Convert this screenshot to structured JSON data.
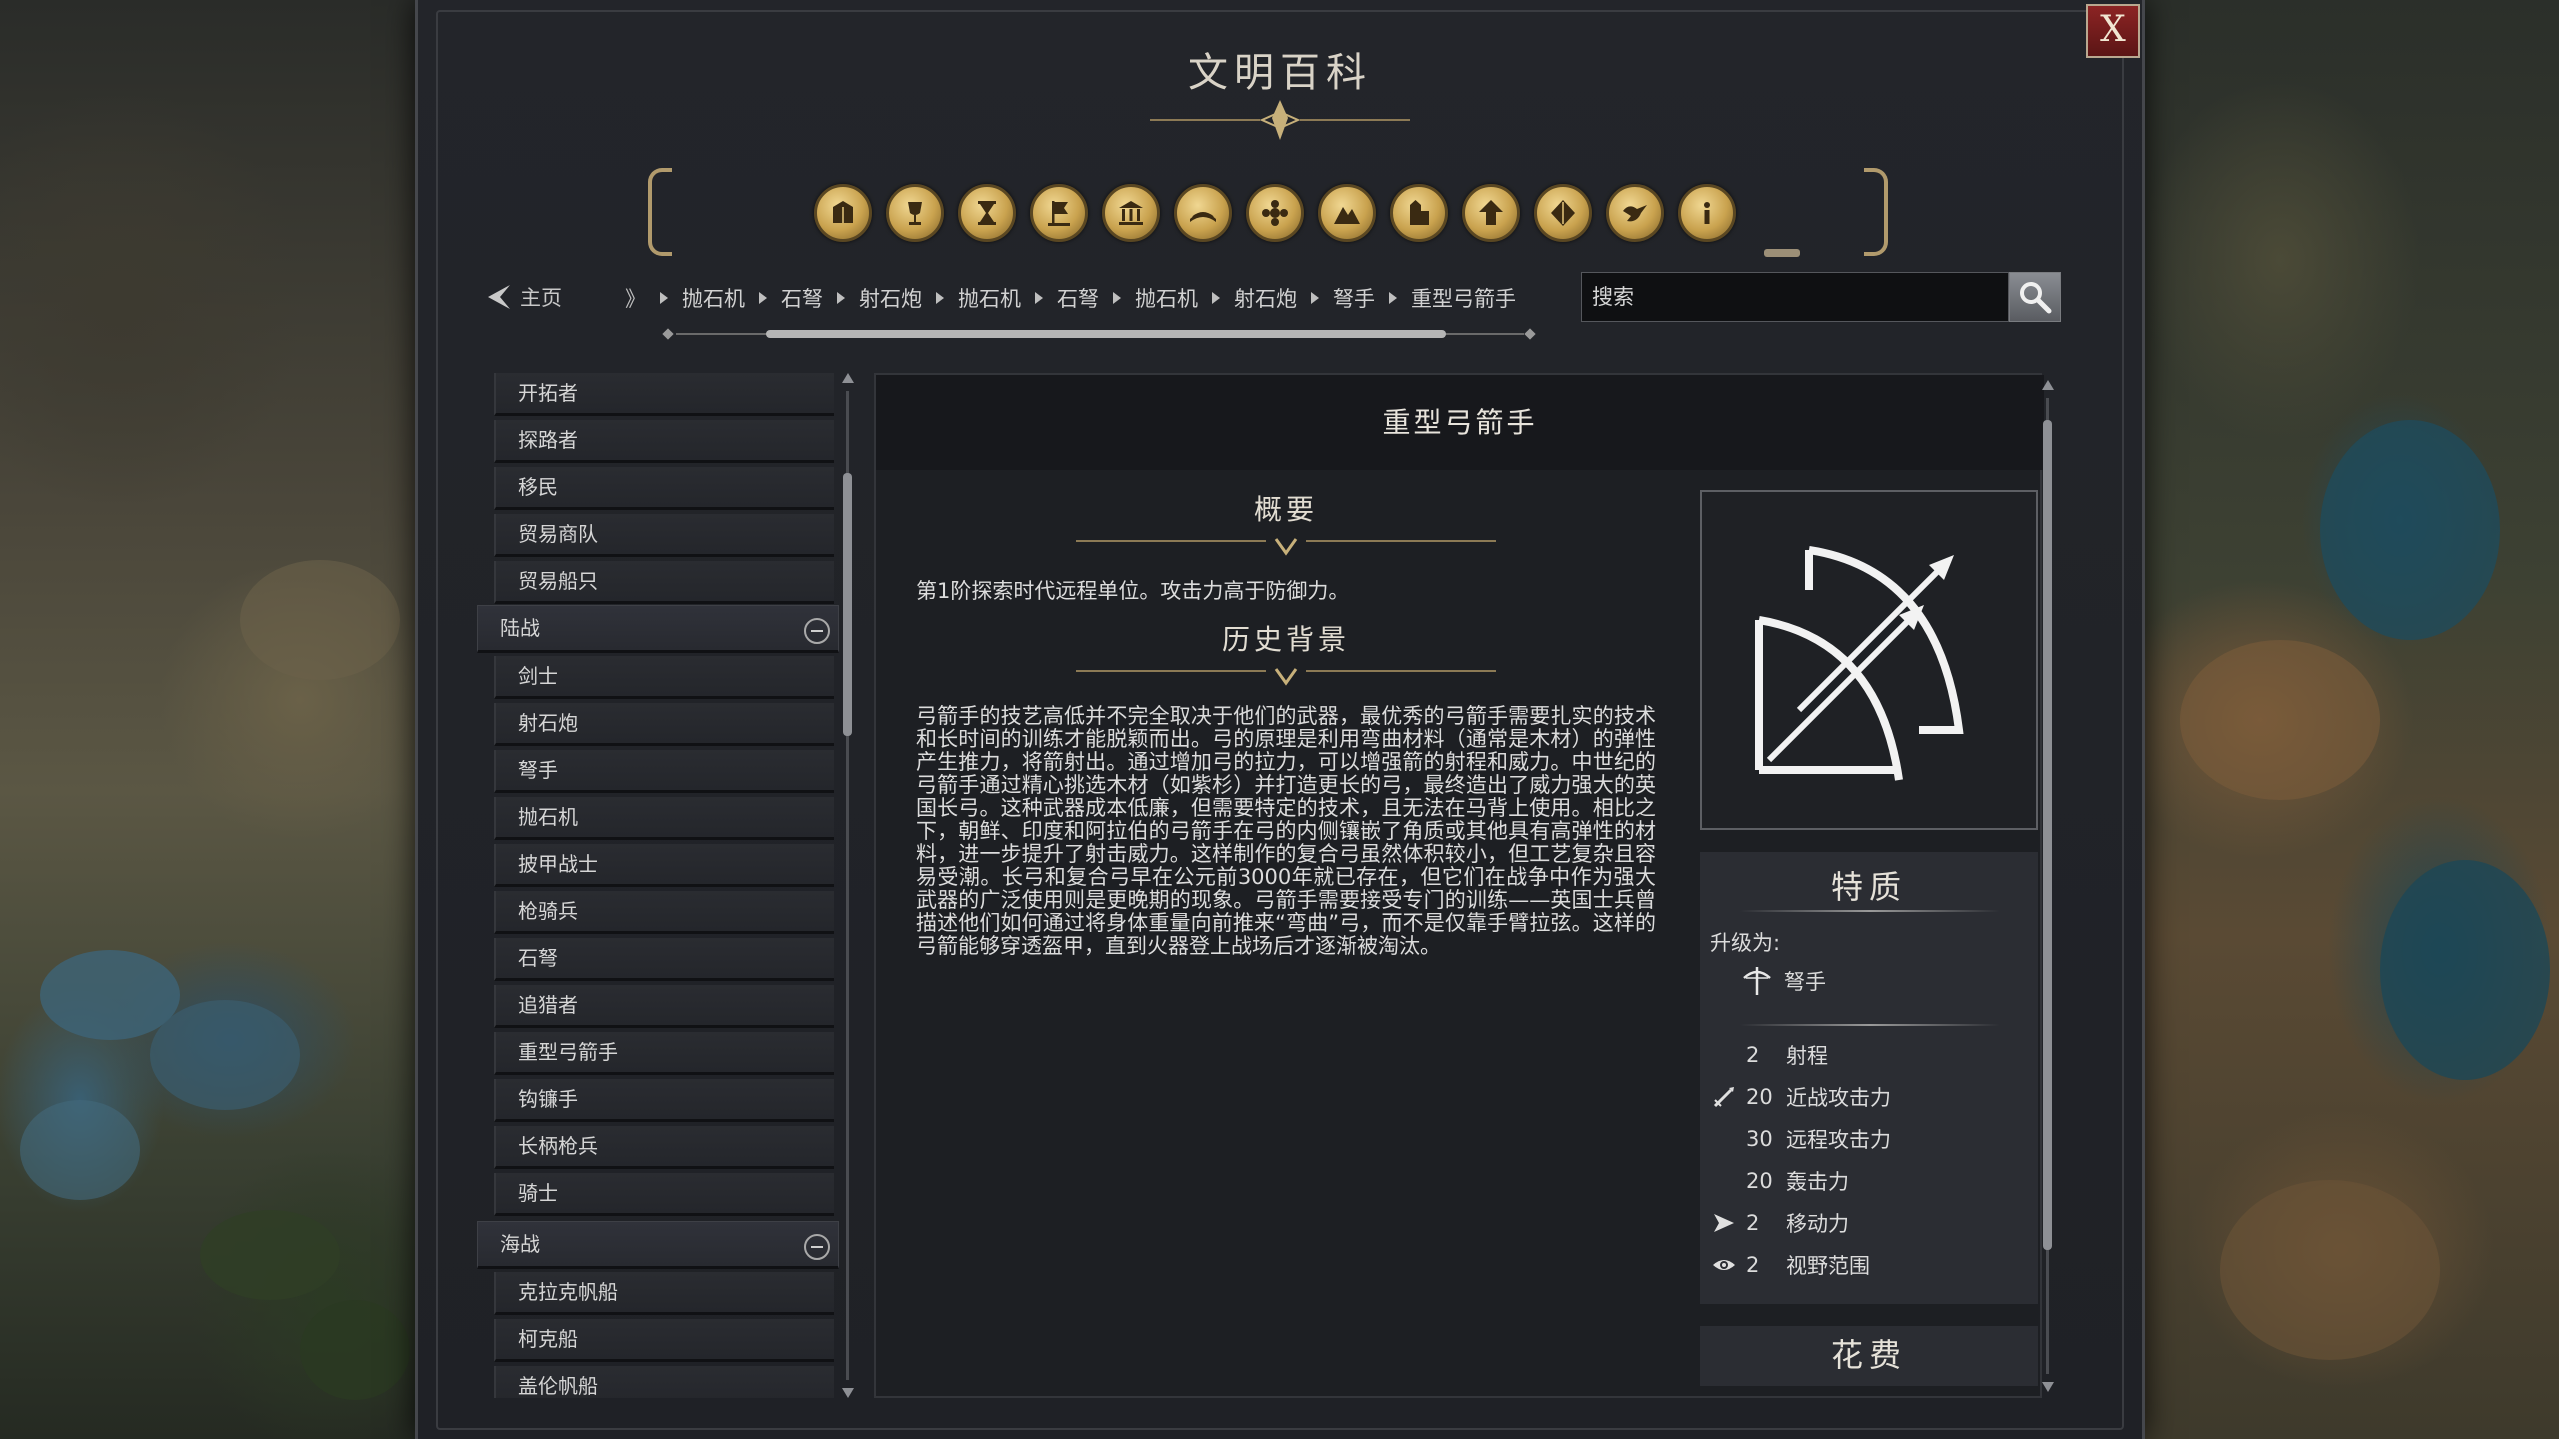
{
  "window": {
    "title": "文明百科",
    "close_label": "X"
  },
  "categories": [
    {
      "icon": "crate-icon"
    },
    {
      "icon": "goblet-icon"
    },
    {
      "icon": "hourglass-icon"
    },
    {
      "icon": "flag-icon"
    },
    {
      "icon": "temple-icon"
    },
    {
      "icon": "book-icon"
    },
    {
      "icon": "gear-flower-icon"
    },
    {
      "icon": "mountain-icon"
    },
    {
      "icon": "building-icon"
    },
    {
      "icon": "arrow-up-icon"
    },
    {
      "icon": "leaf-icon"
    },
    {
      "icon": "dove-icon"
    },
    {
      "icon": "info-icon"
    }
  ],
  "breadcrumb": {
    "home_label": "主页",
    "start_marker": "》",
    "items": [
      "抛石机",
      "石弩",
      "射石炮",
      "抛石机",
      "石弩",
      "抛石机",
      "射石炮",
      "弩手",
      "重型弓箭手"
    ]
  },
  "search": {
    "placeholder": "搜索"
  },
  "sidebar": {
    "items_top": [
      "开拓者",
      "探路者",
      "移民",
      "贸易商队",
      "贸易船只"
    ],
    "group_land": "陆战",
    "items_land": [
      "剑士",
      "射石炮",
      "弩手",
      "抛石机",
      "披甲战士",
      "枪骑兵",
      "石弩",
      "追猎者",
      "重型弓箭手",
      "钩镰手",
      "长柄枪兵",
      "骑士"
    ],
    "group_naval": "海战",
    "items_naval": [
      "克拉克帆船",
      "柯克船",
      "盖伦帆船"
    ]
  },
  "content": {
    "unit_name": "重型弓箭手",
    "summary_title": "概要",
    "summary_text": "第1阶探索时代远程单位。攻击力高于防御力。",
    "history_title": "历史背景",
    "history_text": "弓箭手的技艺高低并不完全取决于他们的武器，最优秀的弓箭手需要扎实的技术和长时间的训练才能脱颖而出。弓的原理是利用弯曲材料（通常是木材）的弹性产生推力，将箭射出。通过增加弓的拉力，可以增强箭的射程和威力。中世纪的弓箭手通过精心挑选木材（如紫杉）并打造更长的弓，最终造出了威力强大的英国长弓。这种武器成本低廉，但需要特定的技术，且无法在马背上使用。相比之下，朝鲜、印度和阿拉伯的弓箭手在弓的内侧镶嵌了角质或其他具有高弹性的材料，进一步提升了射击威力。这样制作的复合弓虽然体积较小，但工艺复杂且容易受潮。长弓和复合弓早在公元前3000年就已存在，但它们在战争中作为强大武器的广泛使用则是更晚期的现象。弓箭手需要接受专门的训练——英国士兵曾描述他们如何通过将身体重量向前推来“弯曲”弓，而不是仅靠手臂拉弦。这样的弓箭能够穿透盔甲，直到火器登上战场后才逐渐被淘汰。"
  },
  "traits": {
    "title": "特质",
    "upgrade_label": "升级为:",
    "upgrade_target": "弩手",
    "stats": [
      {
        "icon": "",
        "value": "2",
        "label": "射程"
      },
      {
        "icon": "sword-icon",
        "value": "20",
        "label": "近战攻击力"
      },
      {
        "icon": "",
        "value": "30",
        "label": "远程攻击力"
      },
      {
        "icon": "",
        "value": "20",
        "label": "轰击力"
      },
      {
        "icon": "move-arrow-icon",
        "value": "2",
        "label": "移动力"
      },
      {
        "icon": "eye-icon",
        "value": "2",
        "label": "视野范围"
      }
    ]
  },
  "cost": {
    "title": "花费"
  }
}
